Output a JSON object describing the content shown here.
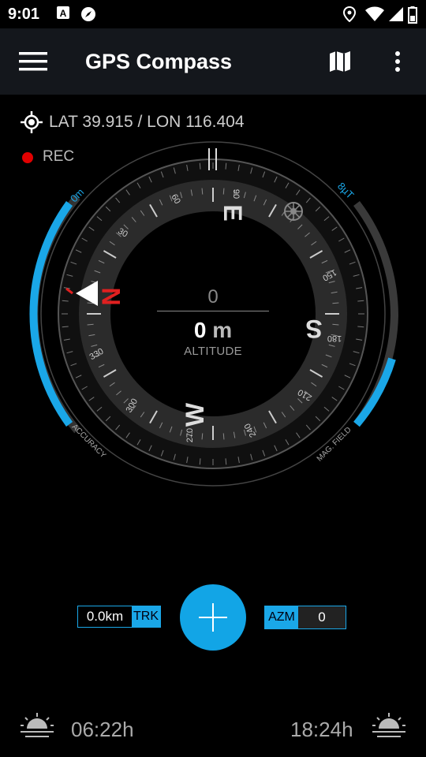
{
  "status_bar": {
    "time": "9:01",
    "left_icons": [
      "a-badge-icon",
      "compass-badge-icon"
    ],
    "right_icons": [
      "location-icon",
      "wifi-icon",
      "signal-icon",
      "battery-icon"
    ]
  },
  "app_bar": {
    "title": "GPS Compass",
    "icons": [
      "menu-icon",
      "map-icon",
      "more-vert-icon"
    ]
  },
  "location": {
    "text": "LAT 39.915 / LON 116.404"
  },
  "recording": {
    "label": "REC",
    "color": "#e10000"
  },
  "compass": {
    "cardinals": {
      "n": "N",
      "e": "E",
      "s": "S",
      "w": "W"
    },
    "degree_labels": [
      "30",
      "60",
      "90",
      "150",
      "180",
      "210",
      "240",
      "270",
      "300",
      "330"
    ],
    "accuracy": {
      "value_label": "0m",
      "caption": "ACCURACY",
      "level": 0.34
    },
    "mag_field": {
      "value_label": "8µT",
      "caption": "MAG. FIELD",
      "level": 0.3
    },
    "heading": "0",
    "altitude_value": "0",
    "altitude_unit": "m",
    "altitude_label": "ALTITUDE",
    "accent": "#1aa7e8",
    "north_color": "#e02020"
  },
  "controls": {
    "trk_value": "0.0km",
    "trk_label": "TRK",
    "azm_label": "AZM",
    "azm_value": "0",
    "fab_icon": "plus-icon"
  },
  "sun": {
    "sunrise": "06:22h",
    "sunset": "18:24h",
    "icons": [
      "sunrise-icon",
      "sunset-icon"
    ]
  }
}
